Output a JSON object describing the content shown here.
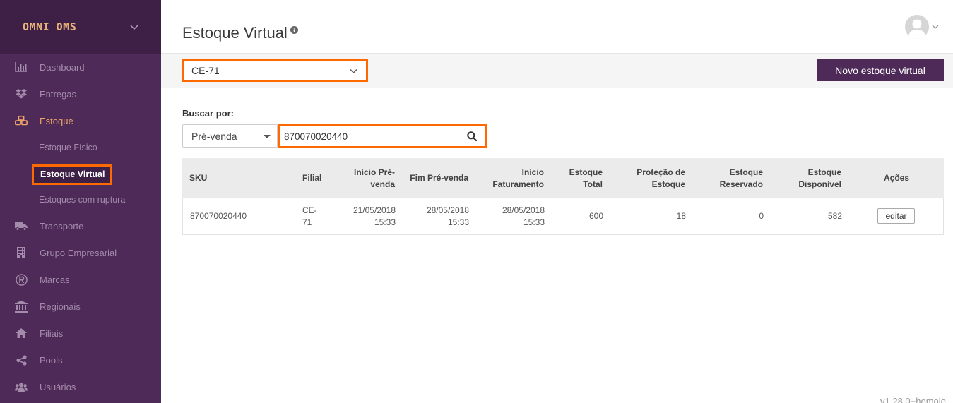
{
  "brand": {
    "name": "OMNI OMS"
  },
  "sidebar": {
    "items": [
      {
        "label": "Dashboard",
        "icon": "bar-chart-icon"
      },
      {
        "label": "Entregas",
        "icon": "dropbox-icon"
      },
      {
        "label": "Estoque",
        "icon": "cubes-icon",
        "active": true
      },
      {
        "label": "Transporte",
        "icon": "truck-icon"
      },
      {
        "label": "Grupo Empresarial",
        "icon": "building-icon"
      },
      {
        "label": "Marcas",
        "icon": "registered-icon"
      },
      {
        "label": "Regionais",
        "icon": "bank-icon"
      },
      {
        "label": "Filiais",
        "icon": "home-icon"
      },
      {
        "label": "Pools",
        "icon": "share-icon"
      },
      {
        "label": "Usuários",
        "icon": "users-icon"
      }
    ],
    "estoque_sub": [
      "Estoque Físico",
      "Estoque Virtual",
      "Estoques com ruptura"
    ]
  },
  "header": {
    "title": "Estoque Virtual"
  },
  "toolbar": {
    "filial_value": "CE-71",
    "new_button": "Novo estoque virtual"
  },
  "search": {
    "label": "Buscar por:",
    "type_value": "Pré-venda",
    "query": "870070020440"
  },
  "table": {
    "headers": {
      "sku": "SKU",
      "filial": "Filial",
      "inicio_pre_venda": [
        "Início Pré-",
        "venda"
      ],
      "fim_pre_venda": "Fim Pré-venda",
      "inicio_faturamento": [
        "Início",
        "Faturamento"
      ],
      "estoque_total": [
        "Estoque",
        "Total"
      ],
      "protecao": [
        "Proteção de",
        "Estoque"
      ],
      "reservado": [
        "Estoque",
        "Reservado"
      ],
      "disponivel": [
        "Estoque",
        "Disponível"
      ],
      "acoes": "Ações"
    },
    "rows": [
      {
        "sku": "870070020440",
        "filial": [
          "CE-",
          "71"
        ],
        "inicio_pre_venda": [
          "21/05/2018",
          "15:33"
        ],
        "fim_pre_venda": [
          "28/05/2018",
          "15:33"
        ],
        "inicio_faturamento": [
          "28/05/2018",
          "15:33"
        ],
        "estoque_total": "600",
        "protecao": "18",
        "reservado": "0",
        "disponivel": "582",
        "action": "editar"
      }
    ]
  },
  "footer": {
    "version": "v1.28.0+homolo"
  },
  "colors": {
    "sidebar": "#4d2a57",
    "brand_bg": "#3e2047",
    "highlight": "#ff6a00",
    "primary": "#4d2a57",
    "brand_text": "#e8b27a"
  }
}
